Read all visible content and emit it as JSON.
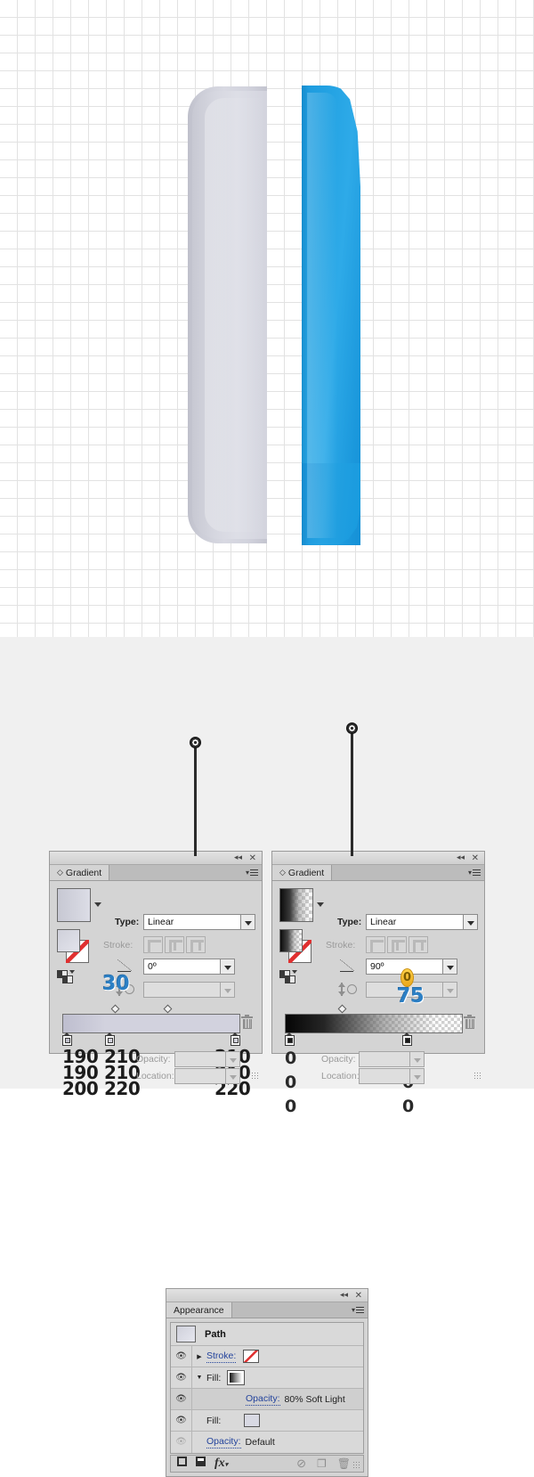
{
  "canvas": {
    "grid_size_px": 20,
    "grid_line_color": "#e2e2e2",
    "background": "#ffffff",
    "shapes": [
      {
        "name": "gray-rounded-bar",
        "fill_gradient": [
          "#bfc0cb",
          "#d8d9e2",
          "#c3c4cf"
        ]
      },
      {
        "name": "blue-rounded-bar",
        "fill_gradient": [
          "#1c9ade",
          "#2eaae8",
          "#1590d6"
        ]
      }
    ]
  },
  "appearance_panel": {
    "title": "Appearance",
    "dock_collapse_icon": "collapse-icon",
    "close_icon": "close-icon",
    "menu_icon": "panel-menu-icon",
    "object_row": {
      "label": "Path",
      "thumbnail": "path-thumbnail"
    },
    "rows": [
      {
        "eye": "eye-icon",
        "disclosure": "triangle-right",
        "label": "Stroke:",
        "link": true,
        "swatch": "none-swatch"
      },
      {
        "eye": "eye-icon",
        "disclosure": "triangle-down",
        "label": "Fill:",
        "link": false,
        "swatch": "gradient-swatch"
      },
      {
        "eye": "eye-icon",
        "disclosure": "",
        "label": "Opacity:",
        "link": true,
        "value": "80% Soft Light"
      },
      {
        "eye": "eye-icon",
        "disclosure": "",
        "label": "Fill:",
        "link": false,
        "swatch": "solid-swatch"
      },
      {
        "eye": "eye-icon-dim",
        "disclosure": "",
        "label": "Opacity:",
        "link": true,
        "value": "Default"
      }
    ],
    "footer_icons": [
      "add-new-stroke-icon",
      "add-new-fill-icon",
      "add-new-effect-icon",
      "clear-appearance-icon",
      "duplicate-item-icon",
      "delete-item-icon"
    ],
    "footer_fx_label": "fx"
  },
  "gradient_left": {
    "title": "Gradient",
    "type_label": "Type:",
    "type_value": "Linear",
    "stroke_label": "Stroke:",
    "angle_label": "angle-icon",
    "angle_value": "0º",
    "aspect_value": "",
    "opacity_label": "Opacity:",
    "location_label": "Location:",
    "opacity_value": "",
    "location_value": "",
    "thumbnail_gradient": [
      "#c7c8d3",
      "#dcdde6"
    ],
    "stops": [
      {
        "position_pct": 0,
        "rgb": [
          "190",
          "190",
          "200"
        ]
      },
      {
        "position_pct": 24,
        "rgb": [
          "210",
          "210",
          "220"
        ]
      },
      {
        "position_pct": 100,
        "rgb": [
          "210",
          "210",
          "220"
        ]
      }
    ],
    "midpoints_pct": [
      11,
      48
    ],
    "annotation_blue": "30",
    "trash_icon": "delete-stop-icon"
  },
  "gradient_right": {
    "title": "Gradient",
    "type_label": "Type:",
    "type_value": "Linear",
    "stroke_label": "Stroke:",
    "angle_label": "angle-icon",
    "angle_value": "90º",
    "aspect_value": "",
    "opacity_label": "Opacity:",
    "location_label": "Location:",
    "opacity_value": "",
    "location_value": "",
    "thumbnail_gradient": [
      "#111111",
      "transparent"
    ],
    "stops": [
      {
        "position_pct": 0,
        "opacity": [
          "0",
          "0",
          "0"
        ]
      },
      {
        "position_pct": 73,
        "opacity": [
          "0",
          "0",
          "0"
        ]
      }
    ],
    "midpoints_pct": [
      36
    ],
    "annotation_blue": "75",
    "annotation_yellow": "0",
    "trash_icon": "delete-stop-icon"
  }
}
